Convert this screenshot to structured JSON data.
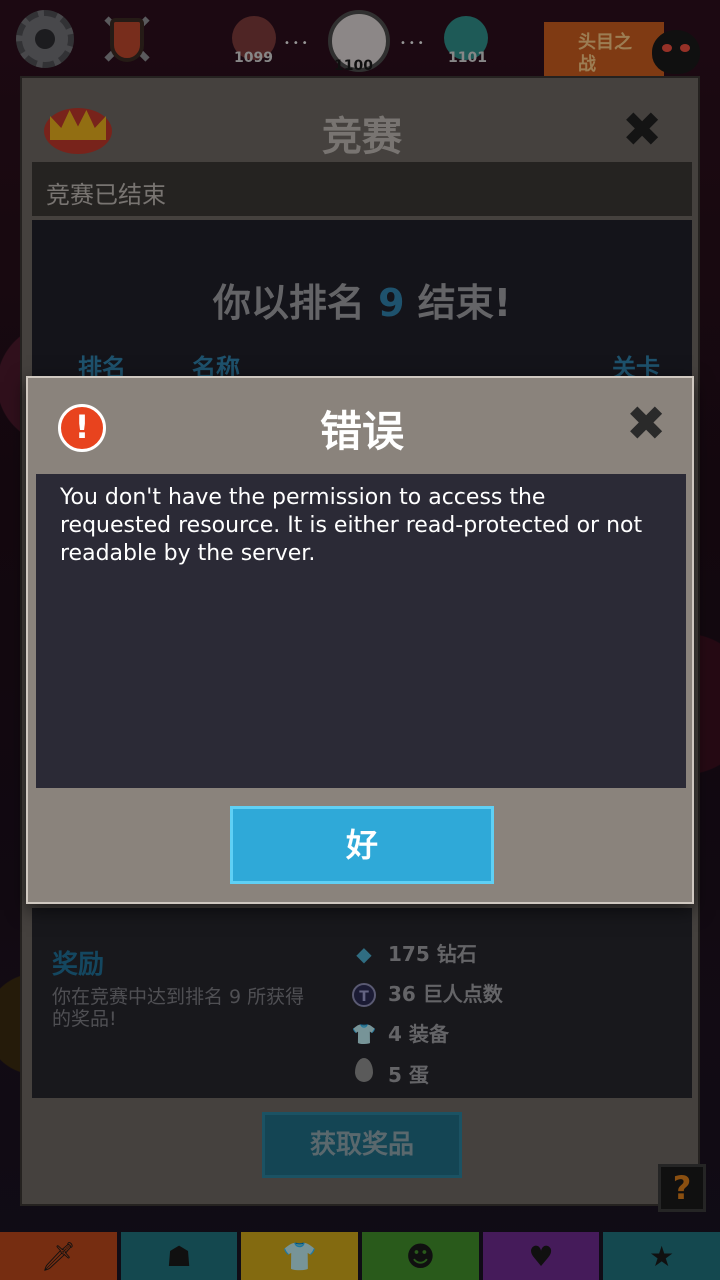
{
  "top_bar": {
    "levels": [
      {
        "number": "1099"
      },
      {
        "number": "1100"
      },
      {
        "number": "1101"
      }
    ],
    "boss_label": "头目之战"
  },
  "competition": {
    "title": "竞赛",
    "status": "竞赛已结束",
    "rank_prefix": "你以排名",
    "rank_value": "9",
    "rank_suffix": "结束!",
    "columns": [
      "排名",
      "名称",
      "关卡"
    ],
    "reward": {
      "title": "奖励",
      "description": "你在竞赛中达到排名 9 所获得的奖品!",
      "items": [
        {
          "icon": "diamond-icon",
          "label": "175 钻石"
        },
        {
          "icon": "giant-points-icon",
          "label": "36 巨人点数"
        },
        {
          "icon": "shirt-icon",
          "label": "4 装备"
        },
        {
          "icon": "egg-icon",
          "label": "5 蛋"
        }
      ]
    },
    "claim_button": "获取奖品",
    "help_button": "?"
  },
  "error_dialog": {
    "title": "错误",
    "message": "You don't have the permission to access the requested resource. It is either read-protected or not readable by the server.",
    "ok_button": "好"
  },
  "bottom_tabs": [
    {
      "name": "weapon",
      "color": "#b5451b",
      "icon": "sword-icon"
    },
    {
      "name": "hero",
      "color": "#1f6f7a",
      "icon": "viking-icon"
    },
    {
      "name": "gear",
      "color": "#c9a41a",
      "icon": "shirt-icon"
    },
    {
      "name": "pet",
      "color": "#3f8a2a",
      "icon": "pet-icon"
    },
    {
      "name": "ability",
      "color": "#6a2a8a",
      "icon": "heart-icon"
    },
    {
      "name": "ranking",
      "color": "#1f6f7a",
      "icon": "star-icon"
    }
  ]
}
